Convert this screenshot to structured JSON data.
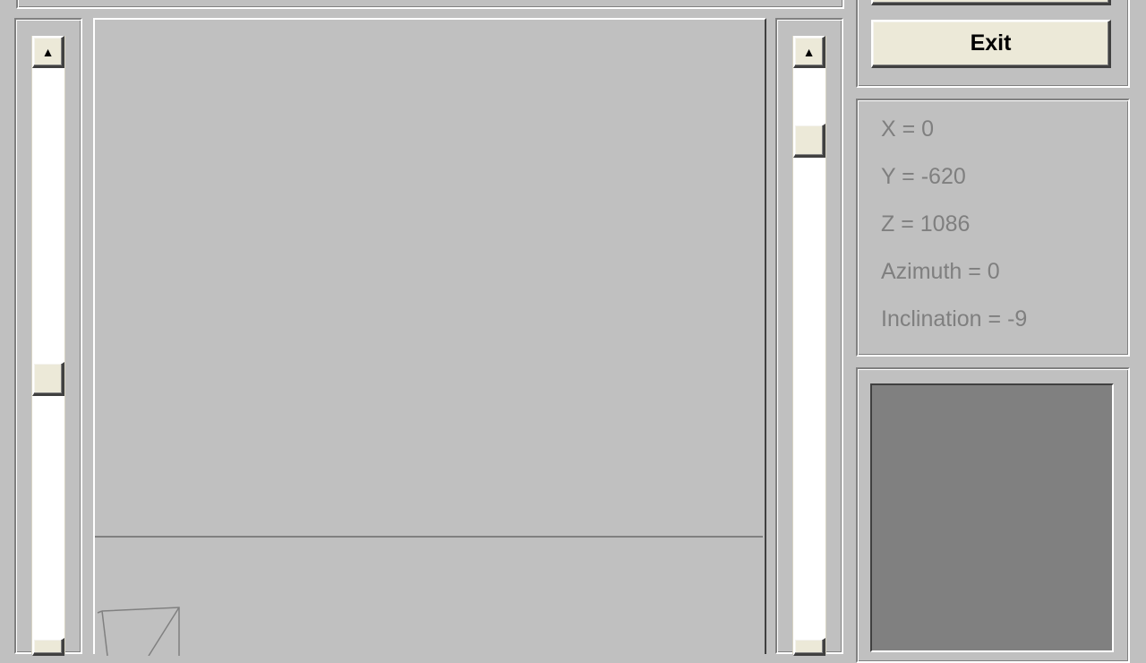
{
  "controls": {
    "exit_label": "Exit"
  },
  "camera_info": {
    "x": "X = 0",
    "y": "Y = -620",
    "z": "Z = 1086",
    "azimuth": "Azimuth = 0",
    "inclination": "Inclination = -9"
  },
  "scrollbars": {
    "left": {
      "up_arrow": "▲",
      "position_fraction": 0.52
    },
    "right": {
      "up_arrow": "▲",
      "position_fraction": 0.08
    }
  },
  "icons": {
    "up_arrow": "scroll-up-arrow-icon"
  },
  "colors": {
    "background": "#c0c0c0",
    "button_face": "#ece9d8",
    "info_text": "#7f7f7f",
    "preview_fill": "#808080",
    "wire": "#808080"
  }
}
